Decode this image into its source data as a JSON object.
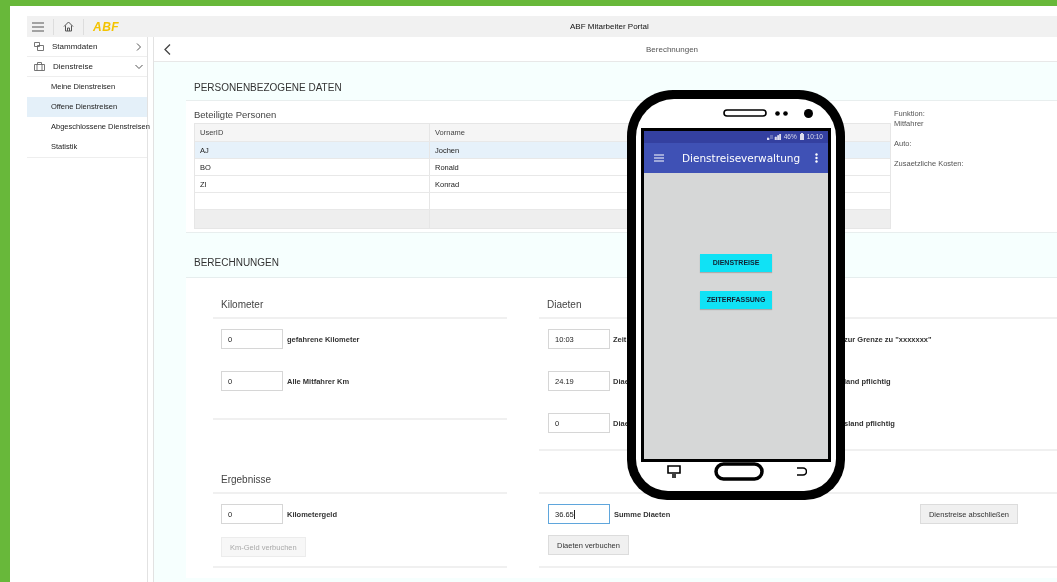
{
  "window": {
    "logo": "ABF",
    "title": "ABF Mitarbeiter Portal"
  },
  "sidebar": {
    "items": [
      {
        "label": "Stammdaten",
        "expanded": false
      },
      {
        "label": "Dienstreise",
        "expanded": true,
        "children": [
          {
            "label": "Meine Dienstreisen",
            "selected": false
          },
          {
            "label": "Offene Dienstreisen",
            "selected": true
          },
          {
            "label": "Abgeschlossene Dienstreisen",
            "selected": false
          },
          {
            "label": "Statistik",
            "selected": false
          }
        ]
      }
    ]
  },
  "page": {
    "title": "Berechnungen"
  },
  "personal": {
    "heading": "PERSONENBEZOGENE DATEN",
    "table_title": "Beteiligte Personen",
    "columns": [
      "UserID",
      "Vorname"
    ],
    "rows": [
      {
        "cells": [
          "AJ",
          "Jochen"
        ],
        "selected": true
      },
      {
        "cells": [
          "BO",
          "Ronald"
        ],
        "selected": false
      },
      {
        "cells": [
          "ZI",
          "Konrad"
        ],
        "selected": false
      }
    ],
    "details": [
      {
        "label": "Funktion:",
        "value": "Mitfahrer"
      },
      {
        "label": "Auto:"
      },
      {
        "label": "Zusaetzliche Kosten:"
      }
    ]
  },
  "calculations": {
    "heading": "BERECHNUNGEN",
    "kilometer": {
      "title": "Kilometer",
      "fields": [
        {
          "value": "0",
          "label": "gefahrene Kilometer"
        },
        {
          "value": "0",
          "label": "Alle Mitfahrer Km"
        }
      ]
    },
    "diaeten": {
      "title": "Diaeten",
      "fields": [
        {
          "value": "10:03",
          "label_parts": [
            "Zeit",
            "zur Grenze zu \"xxxxxxx\""
          ]
        },
        {
          "value": "24.19",
          "label_parts": [
            "Diae",
            "land pflichtig"
          ]
        },
        {
          "value": "0",
          "label_parts": [
            "Diae",
            "sland pflichtig"
          ]
        }
      ]
    },
    "results": {
      "title": "Ergebnisse",
      "left": {
        "value": "0",
        "label": "Kilometergeld",
        "focused": false,
        "button": {
          "label": "Km-Geld verbuchen",
          "disabled": true
        }
      },
      "right": {
        "value": "36.65",
        "label": "Summe Diaeten",
        "focused": true,
        "button": {
          "label": "Diaeten verbuchen",
          "disabled": false
        }
      },
      "finish_button": {
        "label": "Dienstreise abschließen",
        "disabled": false
      }
    }
  },
  "phone": {
    "battery": "46%",
    "time": "10:10",
    "app_title": "Dienstreiseverwaltung",
    "buttons": [
      "DIENSTREISE",
      "ZEITERFASSUNG"
    ]
  }
}
